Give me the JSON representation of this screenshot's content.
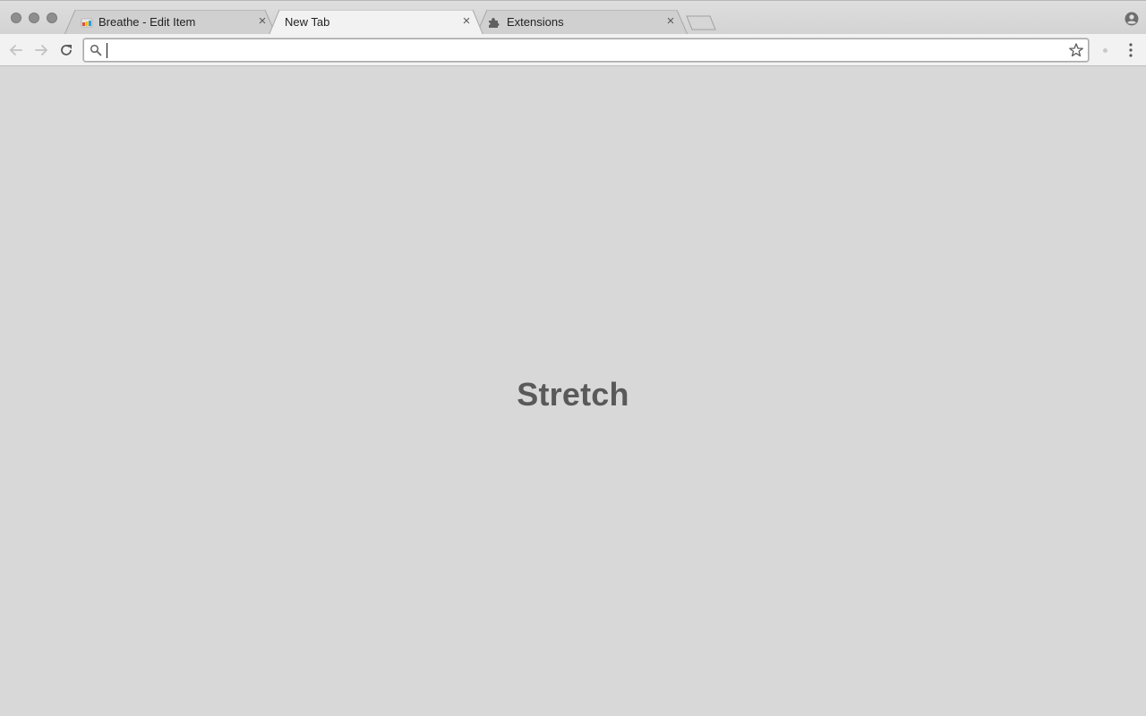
{
  "tabs": [
    {
      "label": "Breathe - Edit Item",
      "favicon": "breathe-app-icon",
      "active": false
    },
    {
      "label": "New Tab",
      "favicon": "",
      "active": true
    },
    {
      "label": "Extensions",
      "favicon": "puzzle-icon",
      "active": false
    }
  ],
  "omnibox": {
    "value": "",
    "placeholder": ""
  },
  "content": {
    "title": "Stretch"
  },
  "colors": {
    "content_bg": "#d8d8d8",
    "title_text": "#595959",
    "active_tab": "#f2f2f2",
    "inactive_tab": "#d0d0d0"
  }
}
